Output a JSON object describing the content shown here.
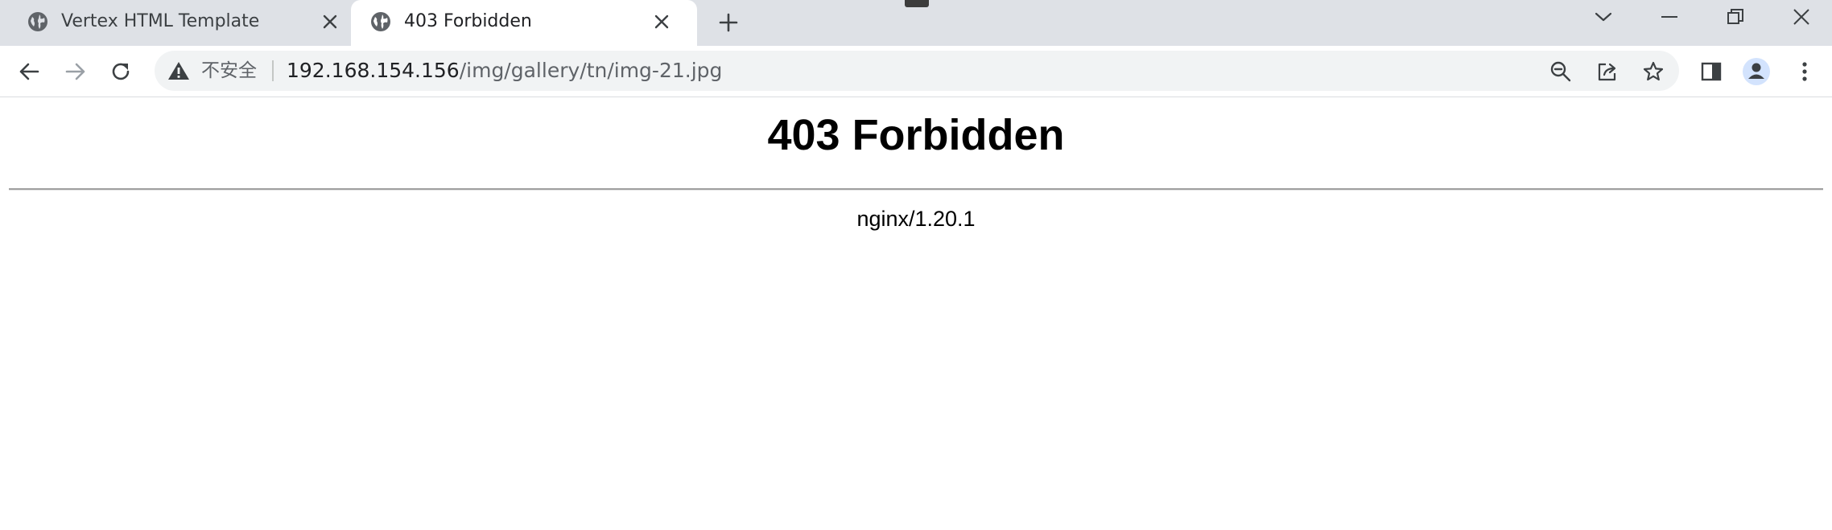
{
  "browser": {
    "tabs": [
      {
        "title": "Vertex HTML Template",
        "active": false
      },
      {
        "title": "403 Forbidden",
        "active": true
      }
    ],
    "address_bar": {
      "security_label": "不安全",
      "url_host": "192.168.154.156",
      "url_path": "/img/gallery/tn/img-21.jpg"
    },
    "icons": {
      "favicon": "globe-icon",
      "tab_close": "close-icon",
      "new_tab": "plus-icon",
      "tab_search": "chevron-down-icon",
      "minimize": "minimize-icon",
      "restore": "restore-icon",
      "close_window": "close-icon",
      "back": "back-arrow-icon",
      "forward": "forward-arrow-icon",
      "reload": "reload-icon",
      "security": "warning-icon",
      "zoom": "zoom-out-icon",
      "share": "share-icon",
      "bookmark": "star-icon",
      "side_panel": "side-panel-icon",
      "profile": "avatar-icon",
      "menu": "kebab-menu-icon"
    },
    "colors": {
      "tabstrip_bg": "#dee1e6",
      "omnibox_bg": "#f1f3f4",
      "text_primary": "#202124",
      "text_secondary": "#5f6368"
    }
  },
  "page": {
    "heading": "403 Forbidden",
    "server_signature": "nginx/1.20.1"
  }
}
